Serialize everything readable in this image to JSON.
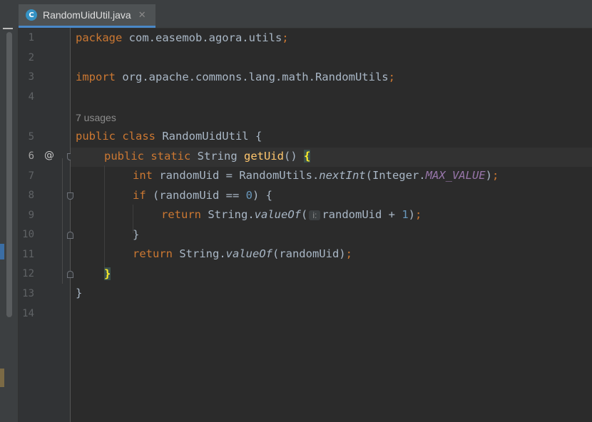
{
  "editor": {
    "tab": {
      "icon_letter": "C",
      "file_name": "RandomUidUtil.java",
      "close_glyph": "✕"
    },
    "usages_hint": "7 usages",
    "parameter_hint": "i:",
    "line_numbers": [
      "1",
      "2",
      "3",
      "4",
      "5",
      "6",
      "7",
      "8",
      "9",
      "10",
      "11",
      "12",
      "13",
      "14"
    ],
    "override_marker": "@",
    "code": {
      "l1_kw": "package",
      "l1_rest": " com.easemob.agora.utils",
      "l1_semi": ";",
      "l3_kw": "import",
      "l3_rest": " org.apache.commons.lang.math.RandomUtils",
      "l3_semi": ";",
      "l5_kw": "public class",
      "l5_rest": " RandomUidUtil {",
      "l6_kw": "public static",
      "l6_type": " String ",
      "l6_fn": "getUid",
      "l6_parens": "() ",
      "l6_brace": "{",
      "l7_kw": "int",
      "l7_a": " randomUid = RandomUtils.",
      "l7_method": "nextInt",
      "l7_b": "(Integer.",
      "l7_const": "MAX_VALUE",
      "l7_c": ")",
      "l7_semi": ";",
      "l8_kw": "if",
      "l8_a": " (randomUid == ",
      "l8_num": "0",
      "l8_b": ") {",
      "l9_kw": "return",
      "l9_a": " String.",
      "l9_method": "valueOf",
      "l9_b": "(",
      "l9_c": "randomUid + ",
      "l9_num": "1",
      "l9_d": ")",
      "l9_semi": ";",
      "l10": "}",
      "l11_kw": "return",
      "l11_a": " String.",
      "l11_method": "valueOf",
      "l11_b": "(randomUid)",
      "l11_semi": ";",
      "l12_brace": "}",
      "l13": "}"
    }
  },
  "colors": {
    "background": "#2b2b2b",
    "keyword": "#cc7832",
    "function": "#ffc66d",
    "constant": "#9876aa",
    "number": "#6897bb",
    "text": "#a9b7c6",
    "tab_underline": "#4a88c7"
  }
}
